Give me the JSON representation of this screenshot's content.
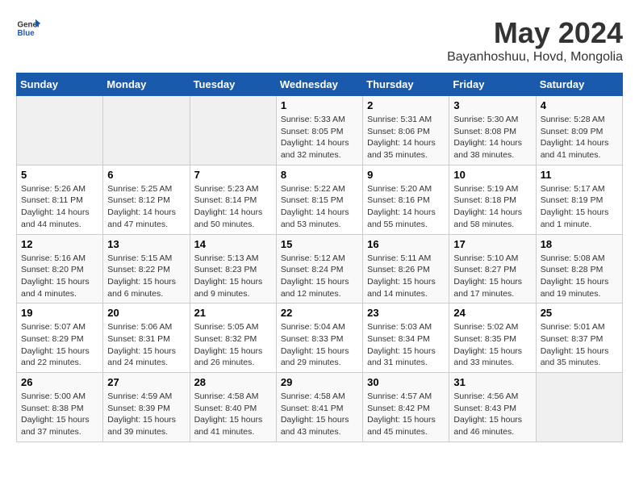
{
  "logo": {
    "general": "General",
    "blue": "Blue"
  },
  "header": {
    "title": "May 2024",
    "subtitle": "Bayanhoshuu, Hovd, Mongolia"
  },
  "days_of_week": [
    "Sunday",
    "Monday",
    "Tuesday",
    "Wednesday",
    "Thursday",
    "Friday",
    "Saturday"
  ],
  "weeks": [
    [
      {
        "day": "",
        "info": ""
      },
      {
        "day": "",
        "info": ""
      },
      {
        "day": "",
        "info": ""
      },
      {
        "day": "1",
        "info": "Sunrise: 5:33 AM\nSunset: 8:05 PM\nDaylight: 14 hours\nand 32 minutes."
      },
      {
        "day": "2",
        "info": "Sunrise: 5:31 AM\nSunset: 8:06 PM\nDaylight: 14 hours\nand 35 minutes."
      },
      {
        "day": "3",
        "info": "Sunrise: 5:30 AM\nSunset: 8:08 PM\nDaylight: 14 hours\nand 38 minutes."
      },
      {
        "day": "4",
        "info": "Sunrise: 5:28 AM\nSunset: 8:09 PM\nDaylight: 14 hours\nand 41 minutes."
      }
    ],
    [
      {
        "day": "5",
        "info": "Sunrise: 5:26 AM\nSunset: 8:11 PM\nDaylight: 14 hours\nand 44 minutes."
      },
      {
        "day": "6",
        "info": "Sunrise: 5:25 AM\nSunset: 8:12 PM\nDaylight: 14 hours\nand 47 minutes."
      },
      {
        "day": "7",
        "info": "Sunrise: 5:23 AM\nSunset: 8:14 PM\nDaylight: 14 hours\nand 50 minutes."
      },
      {
        "day": "8",
        "info": "Sunrise: 5:22 AM\nSunset: 8:15 PM\nDaylight: 14 hours\nand 53 minutes."
      },
      {
        "day": "9",
        "info": "Sunrise: 5:20 AM\nSunset: 8:16 PM\nDaylight: 14 hours\nand 55 minutes."
      },
      {
        "day": "10",
        "info": "Sunrise: 5:19 AM\nSunset: 8:18 PM\nDaylight: 14 hours\nand 58 minutes."
      },
      {
        "day": "11",
        "info": "Sunrise: 5:17 AM\nSunset: 8:19 PM\nDaylight: 15 hours\nand 1 minute."
      }
    ],
    [
      {
        "day": "12",
        "info": "Sunrise: 5:16 AM\nSunset: 8:20 PM\nDaylight: 15 hours\nand 4 minutes."
      },
      {
        "day": "13",
        "info": "Sunrise: 5:15 AM\nSunset: 8:22 PM\nDaylight: 15 hours\nand 6 minutes."
      },
      {
        "day": "14",
        "info": "Sunrise: 5:13 AM\nSunset: 8:23 PM\nDaylight: 15 hours\nand 9 minutes."
      },
      {
        "day": "15",
        "info": "Sunrise: 5:12 AM\nSunset: 8:24 PM\nDaylight: 15 hours\nand 12 minutes."
      },
      {
        "day": "16",
        "info": "Sunrise: 5:11 AM\nSunset: 8:26 PM\nDaylight: 15 hours\nand 14 minutes."
      },
      {
        "day": "17",
        "info": "Sunrise: 5:10 AM\nSunset: 8:27 PM\nDaylight: 15 hours\nand 17 minutes."
      },
      {
        "day": "18",
        "info": "Sunrise: 5:08 AM\nSunset: 8:28 PM\nDaylight: 15 hours\nand 19 minutes."
      }
    ],
    [
      {
        "day": "19",
        "info": "Sunrise: 5:07 AM\nSunset: 8:29 PM\nDaylight: 15 hours\nand 22 minutes."
      },
      {
        "day": "20",
        "info": "Sunrise: 5:06 AM\nSunset: 8:31 PM\nDaylight: 15 hours\nand 24 minutes."
      },
      {
        "day": "21",
        "info": "Sunrise: 5:05 AM\nSunset: 8:32 PM\nDaylight: 15 hours\nand 26 minutes."
      },
      {
        "day": "22",
        "info": "Sunrise: 5:04 AM\nSunset: 8:33 PM\nDaylight: 15 hours\nand 29 minutes."
      },
      {
        "day": "23",
        "info": "Sunrise: 5:03 AM\nSunset: 8:34 PM\nDaylight: 15 hours\nand 31 minutes."
      },
      {
        "day": "24",
        "info": "Sunrise: 5:02 AM\nSunset: 8:35 PM\nDaylight: 15 hours\nand 33 minutes."
      },
      {
        "day": "25",
        "info": "Sunrise: 5:01 AM\nSunset: 8:37 PM\nDaylight: 15 hours\nand 35 minutes."
      }
    ],
    [
      {
        "day": "26",
        "info": "Sunrise: 5:00 AM\nSunset: 8:38 PM\nDaylight: 15 hours\nand 37 minutes."
      },
      {
        "day": "27",
        "info": "Sunrise: 4:59 AM\nSunset: 8:39 PM\nDaylight: 15 hours\nand 39 minutes."
      },
      {
        "day": "28",
        "info": "Sunrise: 4:58 AM\nSunset: 8:40 PM\nDaylight: 15 hours\nand 41 minutes."
      },
      {
        "day": "29",
        "info": "Sunrise: 4:58 AM\nSunset: 8:41 PM\nDaylight: 15 hours\nand 43 minutes."
      },
      {
        "day": "30",
        "info": "Sunrise: 4:57 AM\nSunset: 8:42 PM\nDaylight: 15 hours\nand 45 minutes."
      },
      {
        "day": "31",
        "info": "Sunrise: 4:56 AM\nSunset: 8:43 PM\nDaylight: 15 hours\nand 46 minutes."
      },
      {
        "day": "",
        "info": ""
      }
    ]
  ]
}
